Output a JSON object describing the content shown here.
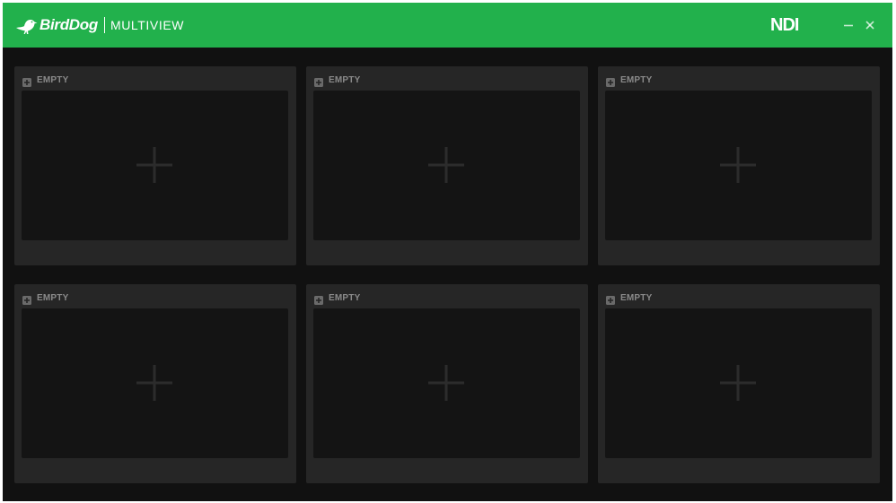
{
  "app": {
    "brand": "BirdDog",
    "product": "MULTIVIEW",
    "ndi_logo": "NDI",
    "colors": {
      "accent": "#22b14c",
      "background": "#111111",
      "panel": "#262626",
      "slot": "#141414",
      "label": "#8a8a8a"
    }
  },
  "window_controls": {
    "minimize_icon": "minimize-icon",
    "close_icon": "close-icon"
  },
  "panels": [
    {
      "label": "EMPTY",
      "icon": "add-source-icon",
      "slot_icon": "plus-icon"
    },
    {
      "label": "EMPTY",
      "icon": "add-source-icon",
      "slot_icon": "plus-icon"
    },
    {
      "label": "EMPTY",
      "icon": "add-source-icon",
      "slot_icon": "plus-icon"
    },
    {
      "label": "EMPTY",
      "icon": "add-source-icon",
      "slot_icon": "plus-icon"
    },
    {
      "label": "EMPTY",
      "icon": "add-source-icon",
      "slot_icon": "plus-icon"
    },
    {
      "label": "EMPTY",
      "icon": "add-source-icon",
      "slot_icon": "plus-icon"
    }
  ]
}
